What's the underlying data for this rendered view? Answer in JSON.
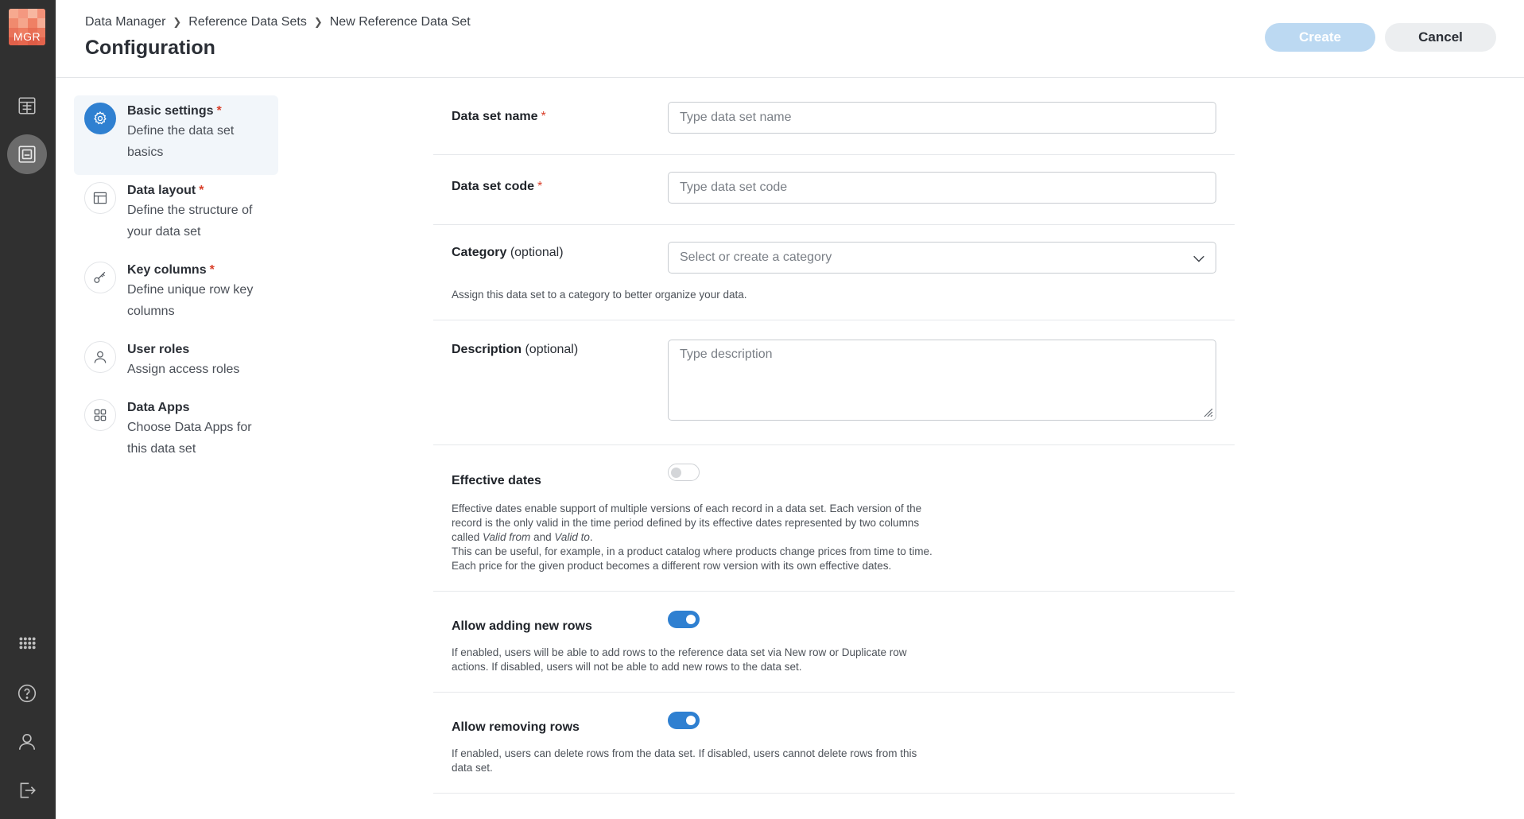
{
  "brand": {
    "logo_text": "MGR"
  },
  "breadcrumb": [
    "Data Manager",
    "Reference Data Sets",
    "New Reference Data Set"
  ],
  "page_title": "Configuration",
  "actions": {
    "create_label": "Create",
    "cancel_label": "Cancel"
  },
  "rail": {
    "top_icons": [
      "table-transform-icon",
      "reference-data-icon"
    ],
    "bottom_icons": [
      "apps-grid-icon",
      "help-icon",
      "user-icon",
      "logout-icon"
    ]
  },
  "steps": [
    {
      "title": "Basic settings",
      "required": "*",
      "desc": "Define the data set basics",
      "icon": "gear-icon",
      "active": true
    },
    {
      "title": "Data layout",
      "required": "*",
      "desc": "Define the structure of your data set",
      "icon": "layout-icon"
    },
    {
      "title": "Key columns",
      "required": "*",
      "desc": "Define unique row key columns",
      "icon": "key-icon"
    },
    {
      "title": "User roles",
      "required": "",
      "desc": "Assign access roles",
      "icon": "user-icon"
    },
    {
      "title": "Data Apps",
      "required": "",
      "desc": "Choose Data Apps for this data set",
      "icon": "grid-icon"
    }
  ],
  "form": {
    "name": {
      "label": "Data set name",
      "required": "*",
      "placeholder": "Type data set name"
    },
    "code": {
      "label": "Data set code",
      "required": "*",
      "placeholder": "Type data set code"
    },
    "category": {
      "label": "Category",
      "optional": "(optional)",
      "placeholder": "Select or create a category",
      "help": "Assign this data set to a category to better organize your data."
    },
    "description": {
      "label": "Description",
      "optional": "(optional)",
      "placeholder": "Type description"
    },
    "effective_dates": {
      "label": "Effective dates",
      "enabled": false,
      "help_lines": {
        "l1": "Effective dates enable support of multiple versions of each record in a data set. Each version of the",
        "l2": "record is the only valid in the time period defined by its effective dates represented by two columns",
        "l3_pre": "called ",
        "l3_em1": "Valid from",
        "l3_mid": " and ",
        "l3_em2": "Valid to",
        "l3_post": ".",
        "l4": "This can be useful, for example, in a product catalog where products change prices from time to time.",
        "l5": "Each price for the given product becomes a different row version with its own effective dates."
      }
    },
    "allow_adding": {
      "label": "Allow adding new rows",
      "enabled": true,
      "help_l1": "If enabled, users will be able to add rows to the reference data set via New row or Duplicate row",
      "help_l2": "actions. If disabled, users will not be able to add new rows to the data set."
    },
    "allow_removing": {
      "label": "Allow removing rows",
      "enabled": true,
      "help_l1": "If enabled, users can delete rows from the data set. If disabled, users cannot delete rows from this",
      "help_l2": "data set."
    }
  }
}
